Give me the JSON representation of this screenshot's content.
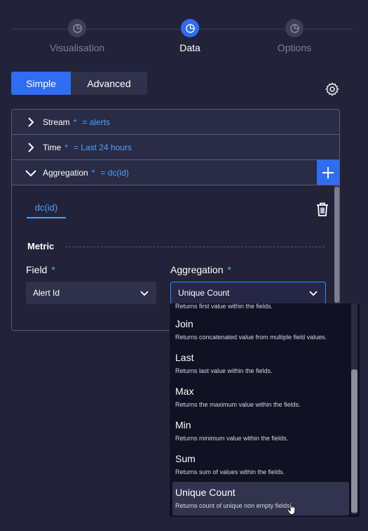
{
  "stepper": {
    "steps": [
      {
        "label": "Visualisation",
        "active": false
      },
      {
        "label": "Data",
        "active": true
      },
      {
        "label": "Options",
        "active": false
      }
    ]
  },
  "mode_toggle": {
    "simple": "Simple",
    "advanced": "Advanced",
    "selected": "Simple"
  },
  "settings_icon": "gear-icon",
  "query": {
    "stream": {
      "label": "Stream",
      "required": "*",
      "value": "= alerts"
    },
    "time": {
      "label": "Time",
      "required": "*",
      "value": "= Last 24 hours"
    },
    "aggregation": {
      "label": "Aggregation",
      "required": "*",
      "value": "= dc(id)",
      "tab": "dc(id)",
      "section_title": "Metric",
      "field": {
        "label": "Field",
        "required": "*",
        "value": "Alert Id"
      },
      "agg_select": {
        "label": "Aggregation",
        "required": "*",
        "value": "Unique Count"
      }
    }
  },
  "dropdown": {
    "partial_top": "Returns first value within the fields.",
    "options": [
      {
        "title": "Join",
        "desc": "Returns concatenated value from multiple field values."
      },
      {
        "title": "Last",
        "desc": "Returns last value within the fields."
      },
      {
        "title": "Max",
        "desc": "Returns the maximum value within the fields."
      },
      {
        "title": "Min",
        "desc": "Returns minimum value within the fields."
      },
      {
        "title": "Sum",
        "desc": "Returns sum of values within the fields."
      },
      {
        "title": "Unique Count",
        "desc": "Returns count of unique non empty fields.",
        "selected": true
      }
    ]
  },
  "colors": {
    "accent": "#2f6df5",
    "link": "#4aa3ff",
    "background": "#222339"
  }
}
